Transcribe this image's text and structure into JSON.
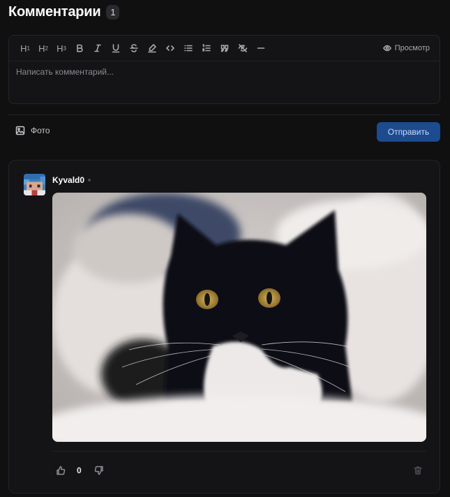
{
  "header": {
    "title": "Комментарии",
    "count": "1"
  },
  "editor": {
    "toolbar": [
      {
        "name": "heading-1-button",
        "label": "H",
        "sub": "1"
      },
      {
        "name": "heading-2-button",
        "label": "H",
        "sub": "2"
      },
      {
        "name": "heading-3-button",
        "label": "H",
        "sub": "3"
      },
      {
        "name": "bold-button",
        "icon": "bold-icon"
      },
      {
        "name": "italic-button",
        "icon": "italic-icon"
      },
      {
        "name": "underline-button",
        "icon": "underline-icon"
      },
      {
        "name": "strikethrough-button",
        "icon": "strikethrough-icon"
      },
      {
        "name": "highlight-button",
        "icon": "highlighter-icon"
      },
      {
        "name": "code-button",
        "icon": "code-icon"
      },
      {
        "name": "bullet-list-button",
        "icon": "bullet-list-icon"
      },
      {
        "name": "ordered-list-button",
        "icon": "ordered-list-icon"
      },
      {
        "name": "quote-button",
        "icon": "quote-icon"
      },
      {
        "name": "spoiler-button",
        "icon": "eye-off-icon"
      },
      {
        "name": "horizontal-rule-button",
        "icon": "minus-icon"
      }
    ],
    "preview_label": "Просмотр",
    "placeholder": "Написать комментарий..."
  },
  "actions": {
    "photo_label": "Фото",
    "send_label": "Отправить"
  },
  "comment": {
    "author": "Kyvald0",
    "score": "0"
  },
  "colors": {
    "background": "#101011",
    "card": "#141416",
    "accent": "#1c4b8f"
  }
}
